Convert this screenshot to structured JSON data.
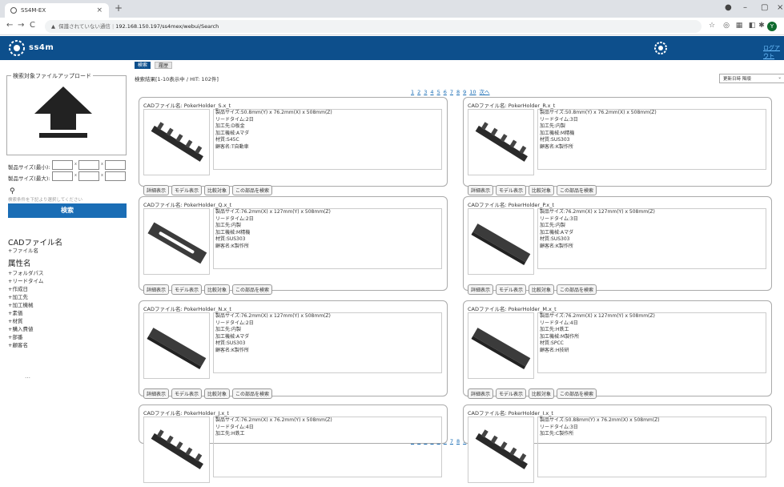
{
  "browser": {
    "tab_title": "SS4M-EX",
    "insecure_label": "保護されていない通信",
    "url": "192.168.150.197/ss4mex/webui/Search",
    "profile_initial": "Y"
  },
  "header": {
    "logo_text": "ss4m",
    "logout_label": "ログアウト"
  },
  "sidebar": {
    "upload_title": "検索対象ファイルアップロード",
    "size_min_label": "製品サイズ(最小):",
    "size_max_label": "製品サイズ(最大):",
    "hint": "検索条件を下記より選択してください",
    "search_button": "検索",
    "facet_cad": "CADファイル名",
    "facet_cad_items": [
      "+ファイル名"
    ],
    "facet_attr": "属性名",
    "facet_attr_items": [
      "+フォルダパス",
      "+リードタイム",
      "+作成日",
      "+加工先",
      "+加工機械",
      "+素価",
      "+材質",
      "+購入費値",
      "+部番",
      "+顧客名"
    ],
    "more": "…"
  },
  "main": {
    "tabs": [
      {
        "label": "検索"
      },
      {
        "label": "履歴"
      }
    ],
    "result_summary": "検索結果[1-10表示中 / HIT: 102件]",
    "sort_value": "更新日時 降順",
    "pages": [
      "1",
      "2",
      "3",
      "4",
      "5",
      "6",
      "7",
      "8",
      "9",
      "10",
      "次へ"
    ],
    "buttons": [
      "詳細表示",
      "モデル表示",
      "比較対象",
      "この部品を検索"
    ],
    "cards": [
      {
        "title": "CADファイル名: PokerHolder_S.x_t",
        "specs": [
          "製品サイズ:50.8mm(Y) x 76.2mm(X) x 508mm(Z)",
          "リードタイム:2日",
          "加工先:D板金",
          "加工機械:Aマダ",
          "材質:S45C",
          "顧客名:T自動車"
        ]
      },
      {
        "title": "CADファイル名: PokerHolder_R.x_t",
        "specs": [
          "製品サイズ:50.8mm(Y) x 76.2mm(X) x 508mm(Z)",
          "リードタイム:3日",
          "加工先:内製",
          "加工機械:M精機",
          "材質:SUS303",
          "顧客名:K製作所"
        ]
      },
      {
        "title": "CADファイル名: PokerHolder_Q.x_t",
        "specs": [
          "製品サイズ:76.2mm(X) x 127mm(Y) x 508mm(Z)",
          "リードタイム:2日",
          "加工先:内製",
          "加工機械:M精機",
          "材質:SUS303",
          "顧客名:K製作所"
        ]
      },
      {
        "title": "CADファイル名: PokerHolder_P.x_t",
        "specs": [
          "製品サイズ:76.2mm(X) x 127mm(Y) x 508mm(Z)",
          "リードタイム:3日",
          "加工先:内製",
          "加工機械:Aマダ",
          "材質:SUS303",
          "顧客名:K製作所"
        ]
      },
      {
        "title": "CADファイル名: PokerHolder_N.x_t",
        "specs": [
          "製品サイズ:76.2mm(X) x 127mm(Y) x 508mm(Z)",
          "リードタイム:2日",
          "加工先:内製",
          "加工機械:Aマダ",
          "材質:SUS303",
          "顧客名:K製作所"
        ]
      },
      {
        "title": "CADファイル名: PokerHolder_M.x_t",
        "specs": [
          "製品サイズ:76.2mm(X) x 127mm(Y) x 508mm(Z)",
          "リードタイム:4日",
          "加工先:H鉄工",
          "加工機械:M製作所",
          "材質:SPCC",
          "顧客名:H技研"
        ]
      },
      {
        "title": "CADファイル名: PokerHolder_J.x_t",
        "specs": [
          "製品サイズ:76.2mm(X) x 76.2mm(Y) x 508mm(Z)",
          "リードタイム:4日",
          "加工先:H鉄工"
        ]
      },
      {
        "title": "CADファイル名: PokerHolder_I.x_t",
        "specs": [
          "製品サイズ:50.88mm(Y) x 76.2mm(X) x 508mm(Z)",
          "リードタイム:3日",
          "加工先:C製作所"
        ]
      }
    ]
  }
}
